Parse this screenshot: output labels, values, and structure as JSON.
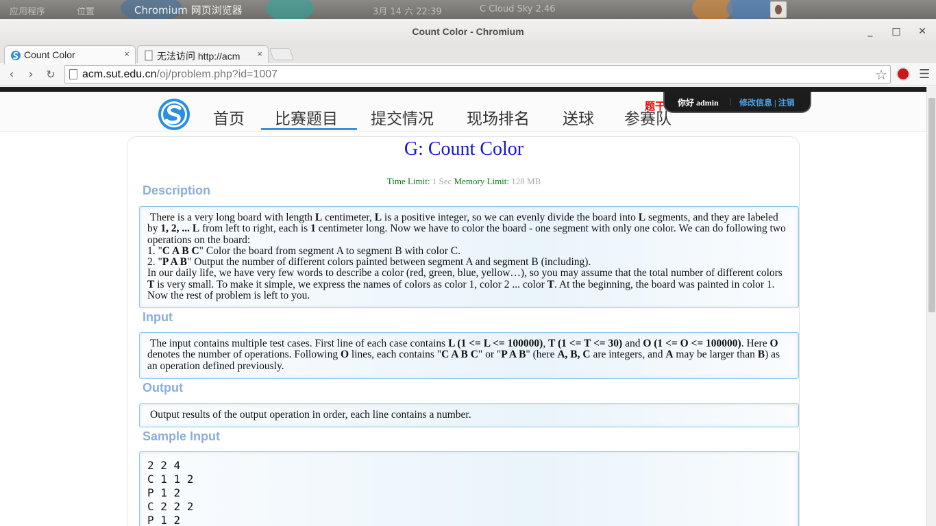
{
  "os_panel": {
    "app_title": "Chromium 网页浏览器",
    "left_text_1": "应用程序",
    "left_text_2": "位置",
    "clock": "3月 14 六 22:39",
    "status": "C Cloud Sky 2.46"
  },
  "window": {
    "title": "Count Color - Chromium"
  },
  "tabs": [
    {
      "label": "Count Color",
      "close": "×"
    },
    {
      "label": "无法访问 http://acm",
      "close": "×"
    }
  ],
  "omnibox": {
    "host": "acm.sut.edu.cn",
    "path": "/oj/problem.php?id=1007"
  },
  "nav": {
    "items": [
      "首页",
      "比赛题目",
      "提交情况",
      "现场排名",
      "送球",
      "参赛队"
    ],
    "marker": "题干"
  },
  "user": {
    "hello": "你好 admin",
    "sep": "|",
    "links": "修改信息 | 注销"
  },
  "problem": {
    "title": "G: Count Color",
    "time_label": "Time Limit:",
    "time_value": "1 Sec",
    "mem_label": "Memory Limit:",
    "mem_value": "128 MB",
    "sections": {
      "description": "Description",
      "input": "Input",
      "output": "Output",
      "sample_input": "Sample Input"
    },
    "output_text": "Output results of the output operation in order, each line contains a number.",
    "sample_input": [
      "2 2 4",
      "C 1 1 2",
      "P 1 2",
      "C 2 2 2",
      "P 1 2"
    ]
  },
  "colors": {
    "accent": "#3b8fd2",
    "title": "#1515d6",
    "section": "#8aaedc",
    "box_border": "#8dc6ea"
  }
}
